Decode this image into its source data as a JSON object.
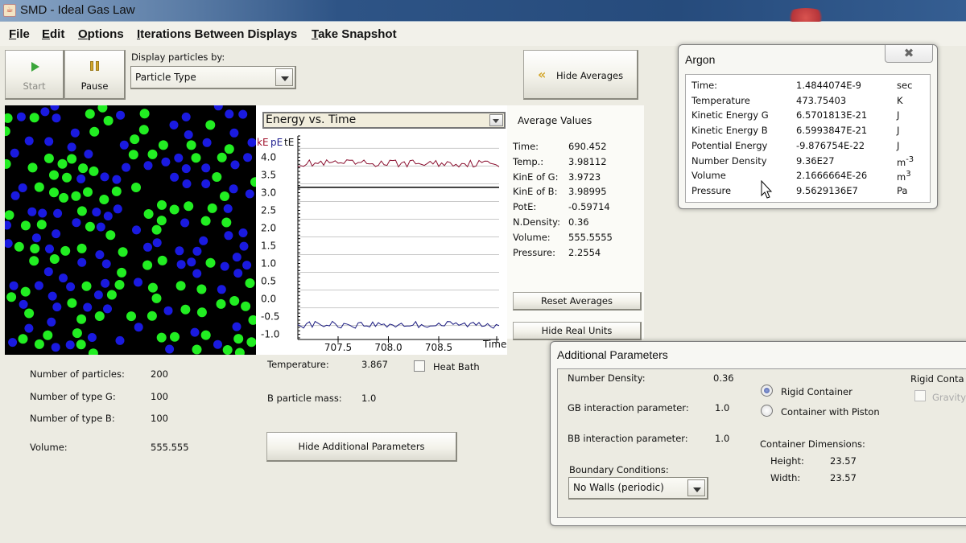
{
  "window": {
    "title": "SMD - Ideal Gas Law"
  },
  "menu": [
    {
      "label": "File",
      "mnemonic": "F",
      "rest": "ile"
    },
    {
      "label": "Edit",
      "mnemonic": "E",
      "rest": "dit"
    },
    {
      "label": "Options",
      "mnemonic": "O",
      "rest": "ptions"
    },
    {
      "label": "Iterations Between Displays",
      "mnemonic": "I",
      "rest": "terations Between Displays"
    },
    {
      "label": "Take Snapshot",
      "mnemonic": "T",
      "rest": "ake Snapshot"
    }
  ],
  "toolbar": {
    "start_label": "Start",
    "start_enabled": false,
    "pause_label": "Pause",
    "display_by_label": "Display particles by:",
    "display_by_value": "Particle Type",
    "hide_averages_label": "Hide Averages"
  },
  "particles": {
    "colors": {
      "G": "#22ee22",
      "B": "#1a1ae0"
    },
    "count_G": 100,
    "count_B": 100
  },
  "chart_data": {
    "type": "line",
    "selector_value": "Energy vs. Time",
    "title": "Energy vs. Time",
    "xlabel": "Time",
    "ylabel_parts": [
      {
        "text": "kE",
        "color": "#a0102a"
      },
      {
        "text": "pE",
        "color": "#202090"
      },
      {
        "text": "tE",
        "color": "#111111"
      }
    ],
    "x_range": [
      707.1,
      709.1
    ],
    "ylim": [
      -1.1,
      4.6
    ],
    "x_ticks": [
      707.5,
      708.0,
      708.5
    ],
    "x_tick_labels": [
      "707.5",
      "708.0",
      "708.5"
    ],
    "y_ticks": [
      4.0,
      3.5,
      3.0,
      2.5,
      2.0,
      1.5,
      1.0,
      0.5,
      0.0,
      -0.5,
      -1.0
    ],
    "y_tick_labels": [
      "4.0",
      "3.5",
      "3.0",
      "2.5",
      "2.0",
      "1.5",
      "1.0",
      "0.5",
      "0.0",
      "-0.5",
      "-1.0"
    ],
    "grid": true,
    "series": [
      {
        "name": "kE",
        "color": "#8b1030",
        "mean": 3.85,
        "approx_range": [
          3.65,
          4.0
        ]
      },
      {
        "name": "tE",
        "color": "#000000",
        "mean": 3.15,
        "approx_range": [
          3.15,
          3.15
        ]
      },
      {
        "name": "pE",
        "color": "#1a1a80",
        "mean": -0.72,
        "approx_range": [
          -0.9,
          -0.55
        ]
      }
    ]
  },
  "averages": {
    "heading": "Average Values",
    "rows": [
      {
        "label": "Time:",
        "value": "690.452"
      },
      {
        "label": "Temp.:",
        "value": "3.98112"
      },
      {
        "label": "KinE of G:",
        "value": "3.9723"
      },
      {
        "label": "KinE of B:",
        "value": "3.98995"
      },
      {
        "label": "PotE:",
        "value": "-0.59714"
      },
      {
        "label": "N.Density:",
        "value": "0.36"
      },
      {
        "label": "Volume:",
        "value": "555.5555"
      },
      {
        "label": "Pressure:",
        "value": "2.2554"
      }
    ],
    "reset_label": "Reset Averages",
    "hide_units_label": "Hide Real Units"
  },
  "argon": {
    "title": "Argon",
    "rows": [
      {
        "label": "Time:",
        "value": "1.4844074E-9",
        "unit": "sec",
        "sup": ""
      },
      {
        "label": "Temperature",
        "value": "473.75403",
        "unit": "K",
        "sup": ""
      },
      {
        "label": "Kinetic Energy G",
        "value": "6.5701813E-21",
        "unit": "J",
        "sup": ""
      },
      {
        "label": "Kinetic Energy B",
        "value": "6.5993847E-21",
        "unit": "J",
        "sup": ""
      },
      {
        "label": "Potential Energy",
        "value": "-9.876754E-22",
        "unit": "J",
        "sup": ""
      },
      {
        "label": "Number Density",
        "value": "9.36E27",
        "unit": "m",
        "sup": "-3"
      },
      {
        "label": "Volume",
        "value": "2.1666664E-26",
        "unit": "m",
        "sup": "3"
      },
      {
        "label": "Pressure",
        "value": "9.5629136E7",
        "unit": "Pa",
        "sup": ""
      }
    ]
  },
  "system": {
    "rows": [
      {
        "label": "Number of particles:",
        "value": "200"
      },
      {
        "label": "Number of type G:",
        "value": "100"
      },
      {
        "label": "Number of type B:",
        "value": "100"
      },
      {
        "label": "Volume:",
        "value": "555.555"
      }
    ],
    "temperature_label": "Temperature:",
    "temperature_value": "3.867",
    "heat_bath_label": "Heat Bath",
    "heat_bath_checked": false,
    "b_mass_label": "B particle mass:",
    "b_mass_value": "1.0",
    "hide_additional_label": "Hide Additional Parameters"
  },
  "additional": {
    "title": "Additional Parameters",
    "number_density_label": "Number Density:",
    "number_density_value": "0.36",
    "gb_label": "GB interaction parameter:",
    "gb_value": "1.0",
    "bb_label": "BB interaction parameter:",
    "bb_value": "1.0",
    "boundary_label": "Boundary Conditions:",
    "boundary_value": "No Walls (periodic)",
    "container_options": [
      {
        "label": "Rigid Container",
        "selected": true
      },
      {
        "label": "Container with Piston",
        "selected": false
      }
    ],
    "dimensions_label": "Container Dimensions:",
    "height_label": "Height:",
    "height_value": "23.57",
    "width_label": "Width:",
    "width_value": "23.57",
    "rigid_heading": "Rigid Conta",
    "gravity_label": "Gravity",
    "gravity_enabled": false
  }
}
